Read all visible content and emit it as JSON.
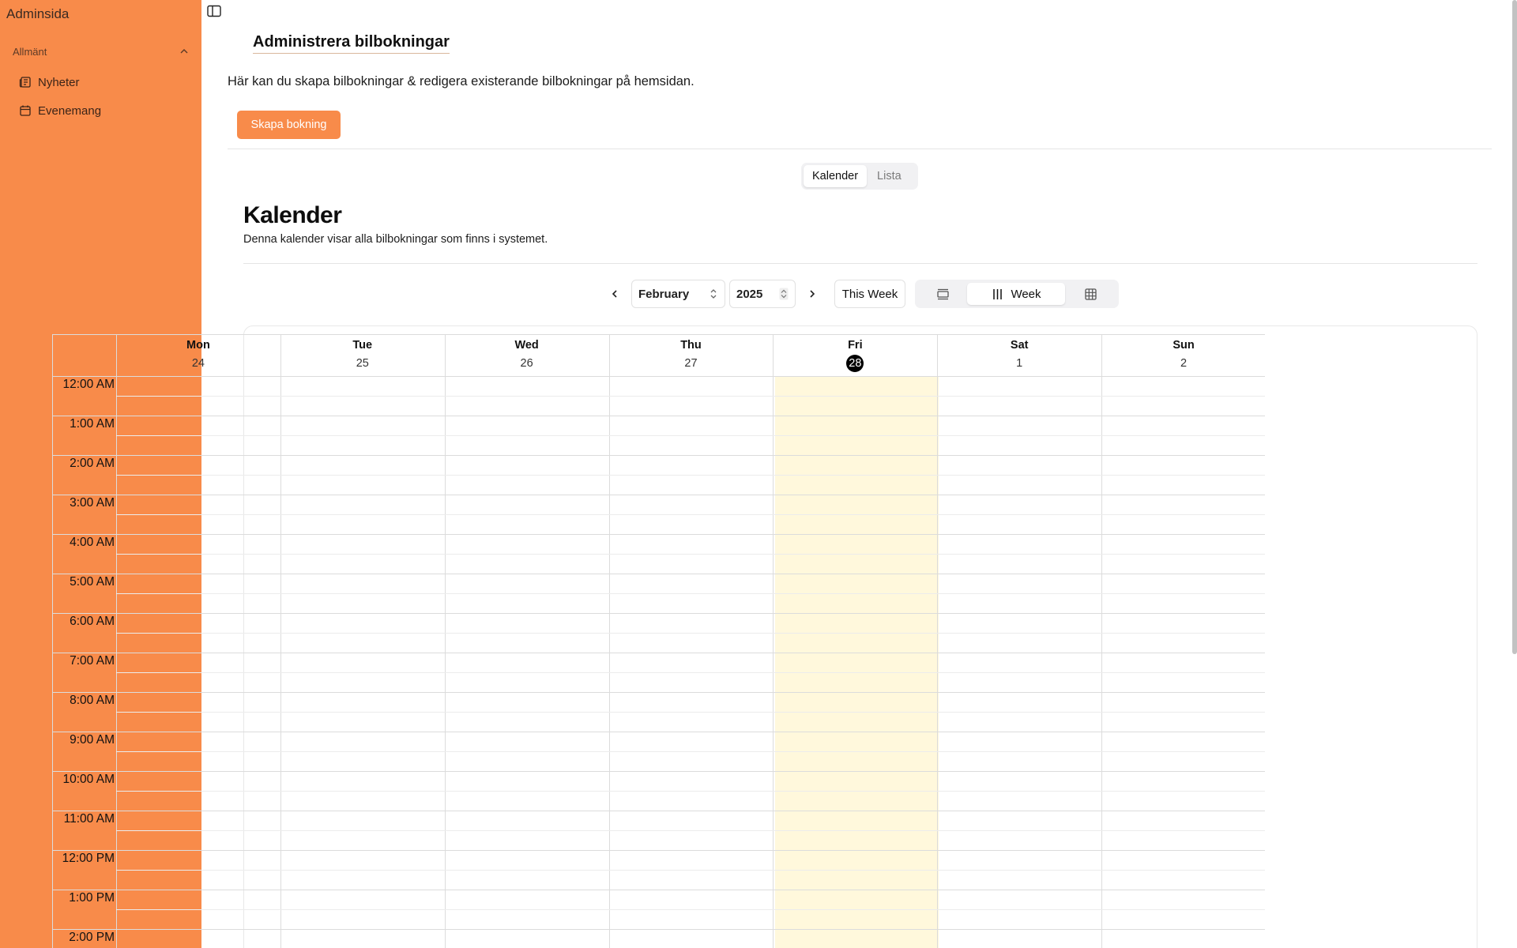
{
  "sidebar": {
    "brand": "Adminsida",
    "group_label": "Allmänt",
    "items": [
      {
        "label": "Nyheter",
        "icon": "newspaper-icon"
      },
      {
        "label": "Evenemang",
        "icon": "calendar-icon"
      }
    ]
  },
  "header": {
    "title": "Administrera bilbokningar",
    "description": "Här kan du skapa bilbokningar & redigera existerande bilbokningar på hemsidan.",
    "create_button": "Skapa bokning"
  },
  "view_tabs": [
    {
      "label": "Kalender",
      "active": true
    },
    {
      "label": "Lista",
      "active": false
    }
  ],
  "calendar": {
    "title": "Kalender",
    "subtitle": "Denna kalender visar alla bilbokningar som finns i systemet.",
    "month": "February",
    "year": "2025",
    "this_week_label": "This Week",
    "view_modes": [
      {
        "label": "",
        "icon": "day-view-icon",
        "active": false
      },
      {
        "label": "Week",
        "icon": "week-columns-icon",
        "active": true
      },
      {
        "label": "",
        "icon": "month-grid-icon",
        "active": false
      }
    ],
    "days": [
      {
        "name": "Mon",
        "date": "24",
        "today": false
      },
      {
        "name": "Tue",
        "date": "25",
        "today": false
      },
      {
        "name": "Wed",
        "date": "26",
        "today": false
      },
      {
        "name": "Thu",
        "date": "27",
        "today": false
      },
      {
        "name": "Fri",
        "date": "28",
        "today": true
      },
      {
        "name": "Sat",
        "date": "1",
        "today": false
      },
      {
        "name": "Sun",
        "date": "2",
        "today": false
      }
    ],
    "hours": [
      "12:00 AM",
      "1:00 AM",
      "2:00 AM",
      "3:00 AM",
      "4:00 AM",
      "5:00 AM",
      "6:00 AM",
      "7:00 AM",
      "8:00 AM",
      "9:00 AM",
      "10:00 AM",
      "11:00 AM",
      "12:00 PM",
      "1:00 PM",
      "2:00 PM"
    ]
  },
  "colors": {
    "sidebar_bg": "#f88b4a",
    "accent": "#f88b4a",
    "today_column": "#fff8dc"
  }
}
